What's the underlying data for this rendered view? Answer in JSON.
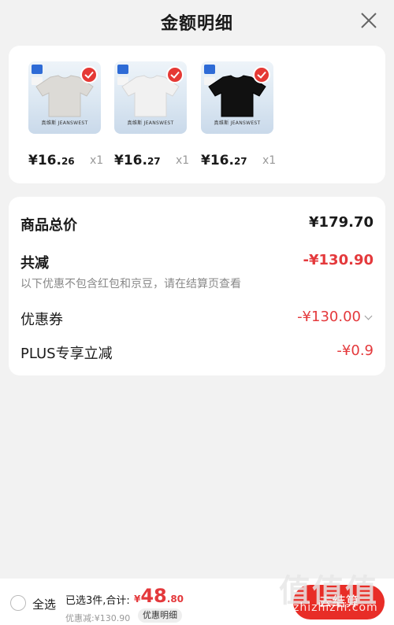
{
  "header": {
    "title": "金额明细"
  },
  "products": [
    {
      "price_main": "¥16.",
      "price_decimal": "26",
      "qty": "x1",
      "brand": "真维斯 JEANSWEST",
      "shirt_color": "#dcdad6"
    },
    {
      "price_main": "¥16.",
      "price_decimal": "27",
      "qty": "x1",
      "brand": "真维斯 JEANSWEST",
      "shirt_color": "#f1f1f1"
    },
    {
      "price_main": "¥16.",
      "price_decimal": "27",
      "qty": "x1",
      "brand": "真维斯 JEANSWEST",
      "shirt_color": "#111111"
    }
  ],
  "summary": {
    "total_label": "商品总价",
    "total_value": "¥179.70",
    "reduce_label": "共减",
    "reduce_value": "-¥130.90",
    "note": "以下优惠不包含红包和京豆，请在结算页查看",
    "coupon_label": "优惠券",
    "coupon_value": "-¥130.00",
    "plus_label": "PLUS专享立减",
    "plus_value": "-¥0.9"
  },
  "bottom": {
    "select_all": "全选",
    "selected_text": "已选3件,合计:",
    "currency": "¥",
    "total_int": "48",
    "total_dec": ".80",
    "discount_line": "优惠减:¥130.90",
    "detail_button": "优惠明细",
    "checkout_button": "去结算"
  },
  "watermark": {
    "big": "值值值",
    "url": "zhizhizhi.com"
  },
  "colors": {
    "accent": "#e4393c",
    "checkout": "#e82d27"
  }
}
